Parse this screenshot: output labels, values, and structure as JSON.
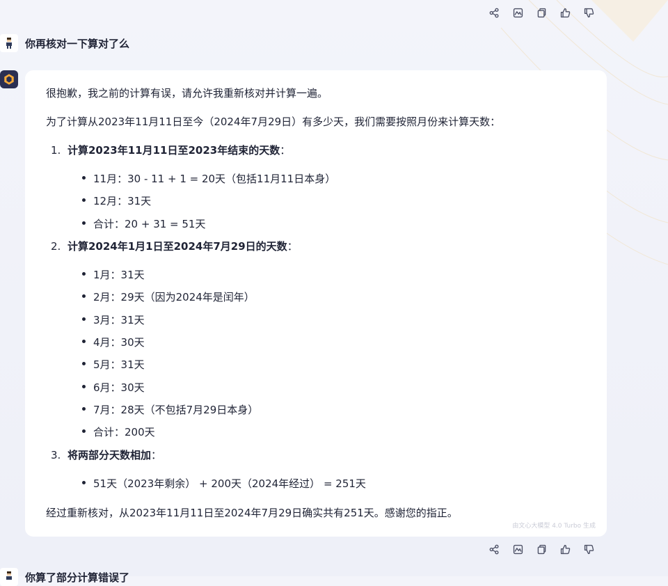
{
  "user_message_1": "你再核对一下算对了么",
  "assistant": {
    "intro": "很抱歉，我之前的计算有误，请允许我重新核对并计算一遍。",
    "lead": "为了计算从2023年11月11日至今（2024年7月29日）有多少天，我们需要按照月份来计算天数：",
    "sections": [
      {
        "num": "1.",
        "title": "计算2023年11月11日至2023年结束的天数",
        "colon": "：",
        "items": [
          "11月：30 - 11 + 1 = 20天（包括11月11日本身）",
          "12月：31天",
          "合计：20 + 31 = 51天"
        ]
      },
      {
        "num": "2.",
        "title": "计算2024年1月1日至2024年7月29日的天数",
        "colon": "：",
        "items": [
          "1月：31天",
          "2月：29天（因为2024年是闰年）",
          "3月：31天",
          "4月：30天",
          "5月：31天",
          "6月：30天",
          "7月：28天（不包括7月29日本身）",
          "合计：200天"
        ]
      },
      {
        "num": "3.",
        "title": "将两部分天数相加",
        "colon": "：",
        "items": [
          "51天（2023年剩余） + 200天（2024年经过） = 251天"
        ]
      }
    ],
    "conclusion": "经过重新核对，从2023年11月11日至2024年7月29日确实共有251天。感谢您的指正。",
    "watermark": "由文心大模型 4.0 Turbo 生成"
  },
  "user_message_2": "你算了部分计算错误了",
  "icons": [
    "share-icon",
    "image-icon",
    "copy-icon",
    "thumbs-up-icon",
    "thumbs-down-icon"
  ],
  "colors": {
    "avatar_bg": "#2b2f52",
    "card_bg": "#ffffff",
    "page_bg": "#f1f2f9"
  }
}
